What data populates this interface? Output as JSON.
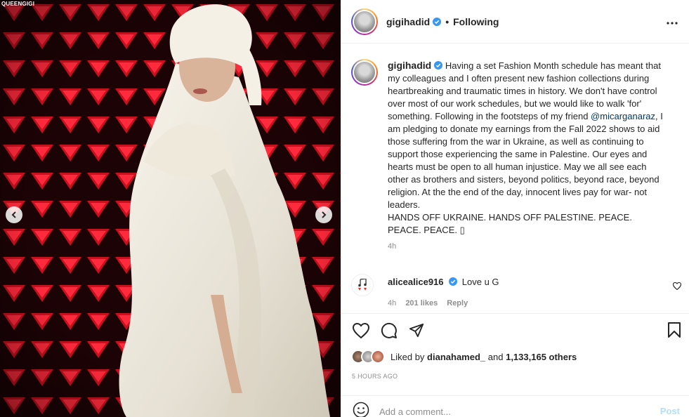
{
  "media": {
    "watermark": "QUEENGIGI"
  },
  "header": {
    "username": "gigihadid",
    "separator": "•",
    "follow_state": "Following"
  },
  "caption": {
    "username": "gigihadid",
    "text_before_mention": "Having a set Fashion Month schedule has meant that my colleagues and I often present new fashion collections during heartbreaking and traumatic times in history. We don't have control over most of our work schedules, but we would like to walk 'for' something. Following in the footsteps of my friend ",
    "mention": "@micarganaraz",
    "text_after_mention": ", I am pledging to donate my earnings from the Fall 2022 shows to aid those suffering from the war in Ukraine, as well as continuing to support those experiencing the same in Palestine. Our eyes and hearts must be open to all human injustice. May we all see each other as brothers and sisters, beyond politics, beyond race, beyond religion. At the the end of the day, innocent lives pay for war- not leaders.",
    "second_paragraph": "HANDS OFF UKRAINE. HANDS OFF PALESTINE. PEACE. PEACE. PEACE. ▯",
    "time": "4h"
  },
  "comment": {
    "username": "alicealice916",
    "text": "Love u G",
    "time": "4h",
    "likes": "201 likes",
    "reply": "Reply"
  },
  "likes": {
    "prefix": "Liked by",
    "first_user": "dianahamed_",
    "conjunction": "and",
    "others": "1,133,165 others"
  },
  "posted_ago": "5 HOURS AGO",
  "add_comment": {
    "placeholder": "Add a comment...",
    "post_label": "Post"
  },
  "colors": {
    "verified": "#3897f0",
    "link": "#00376b",
    "post_disabled": "#b2dffc",
    "muted": "#8e8e8e"
  }
}
